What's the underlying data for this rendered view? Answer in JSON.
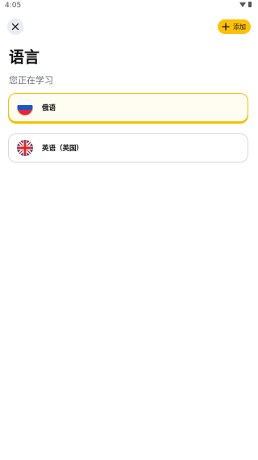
{
  "status": {
    "time": "4:05"
  },
  "header": {
    "add_label": "添加",
    "close_icon": "close-icon",
    "plus_icon": "plus-icon"
  },
  "page": {
    "title": "语言",
    "subtitle": "您正在学习"
  },
  "languages": [
    {
      "label": "俄语",
      "flag": "russia-flag-icon",
      "selected": true
    },
    {
      "label": "英语（英国）",
      "flag": "uk-flag-icon",
      "selected": false
    }
  ],
  "colors": {
    "accent": "#ffc107",
    "selected_border": "#f4c000",
    "card_border": "#d7dadf"
  }
}
